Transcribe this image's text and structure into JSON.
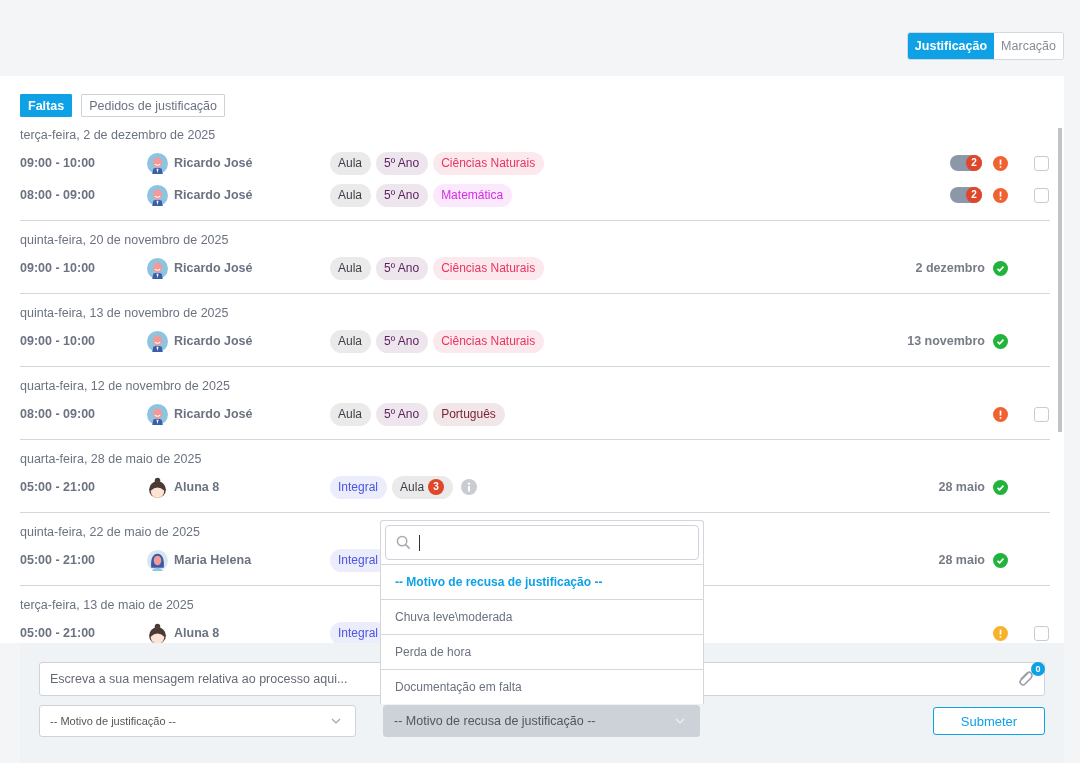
{
  "view_toggle": [
    {
      "label": "Justificação",
      "selected": true
    },
    {
      "label": "Marcação",
      "selected": false
    }
  ],
  "tabs": [
    {
      "label": "Faltas",
      "selected": true
    },
    {
      "label": "Pedidos de justificação",
      "selected": false
    }
  ],
  "groups": [
    {
      "date": "terça-feira, 2 de dezembro de 2025",
      "rows": [
        {
          "time": "09:00 - 10:00",
          "person": "Ricardo José",
          "avatar": {
            "kind": "man"
          },
          "tags": [
            {
              "label": "Aula",
              "color": "#3c3f46"
            },
            {
              "label": "5º Ano",
              "color": "#5c1f5c"
            },
            {
              "label": "Ciências Naturais",
              "color": "#e8345f"
            }
          ],
          "count": "2",
          "status": {
            "kind": "alert"
          },
          "checkbox": {
            "checked": false
          }
        },
        {
          "time": "08:00 - 09:00",
          "person": "Ricardo José",
          "avatar": {
            "kind": "man"
          },
          "tags": [
            {
              "label": "Aula",
              "color": "#3c3f46"
            },
            {
              "label": "5º Ano",
              "color": "#5c1f5c"
            },
            {
              "label": "Matemática",
              "color": "#d62ae6"
            }
          ],
          "count": "2",
          "status": {
            "kind": "alert"
          },
          "checkbox": {
            "checked": false
          }
        }
      ]
    },
    {
      "date": "quinta-feira, 20 de novembro de 2025",
      "rows": [
        {
          "time": "09:00 - 10:00",
          "person": "Ricardo José",
          "avatar": {
            "kind": "man"
          },
          "tags": [
            {
              "label": "Aula",
              "color": "#3c3f46"
            },
            {
              "label": "5º Ano",
              "color": "#5c1f5c"
            },
            {
              "label": "Ciências Naturais",
              "color": "#e8345f"
            }
          ],
          "done_date": "2 dezembro",
          "status": {
            "kind": "ok"
          }
        }
      ]
    },
    {
      "date": "quinta-feira, 13 de novembro de 2025",
      "rows": [
        {
          "time": "09:00 - 10:00",
          "person": "Ricardo José",
          "avatar": {
            "kind": "man"
          },
          "tags": [
            {
              "label": "Aula",
              "color": "#3c3f46"
            },
            {
              "label": "5º Ano",
              "color": "#5c1f5c"
            },
            {
              "label": "Ciências Naturais",
              "color": "#e8345f"
            }
          ],
          "done_date": "13 novembro",
          "status": {
            "kind": "ok"
          }
        }
      ]
    },
    {
      "date": "quarta-feira, 12 de novembro de 2025",
      "rows": [
        {
          "time": "08:00 - 09:00",
          "person": "Ricardo José",
          "avatar": {
            "kind": "man"
          },
          "tags": [
            {
              "label": "Aula",
              "color": "#3c3f46"
            },
            {
              "label": "5º Ano",
              "color": "#5c1f5c"
            },
            {
              "label": "Português",
              "color": "#7c2236"
            }
          ],
          "status": {
            "kind": "alert"
          },
          "checkbox": {
            "checked": false
          }
        }
      ]
    },
    {
      "date": "quarta-feira, 28 de maio de 2025",
      "rows": [
        {
          "time": "05:00 - 21:00",
          "person": "Aluna 8",
          "avatar": {
            "kind": "girl"
          },
          "tags": [
            {
              "label": "Integral",
              "color": "#4a55e0"
            },
            {
              "label": "Aula",
              "color": "#3c3f46",
              "count": "3"
            }
          ],
          "info": true,
          "done_date": "28 maio",
          "status": {
            "kind": "ok"
          }
        }
      ]
    },
    {
      "date": "quinta-feira, 22 de maio de 2025",
      "rows": [
        {
          "time": "05:00 - 21:00",
          "person": "Maria Helena",
          "avatar": {
            "kind": "woman"
          },
          "tags": [
            {
              "label": "Integral",
              "color": "#4a55e0"
            }
          ],
          "done_date": "28 maio",
          "status": {
            "kind": "ok"
          }
        }
      ]
    },
    {
      "date": "terça-feira, 13 de maio de 2025",
      "rows": [
        {
          "time": "05:00 - 21:00",
          "person": "Aluna 8",
          "avatar": {
            "kind": "girl"
          },
          "tags": [
            {
              "label": "Integral",
              "color": "#4a55e0"
            }
          ],
          "status": {
            "kind": "warning"
          },
          "checkbox": {
            "checked": false
          }
        }
      ]
    }
  ],
  "message": {
    "placeholder": "Escreva a sua mensagem relativa ao processo aqui...",
    "attachments": "0"
  },
  "justification_select": {
    "value": "-- Motivo de justificação --"
  },
  "refusal_select": {
    "value": "-- Motivo de recusa de justificação --",
    "expanded": true,
    "options": [
      {
        "label": "-- Motivo de recusa de justificação --",
        "selected": true
      },
      {
        "label": "Chuva leve\\moderada",
        "selected": false
      },
      {
        "label": "Perda de hora",
        "selected": false
      },
      {
        "label": "Documentação em falta",
        "selected": false
      }
    ]
  },
  "submit": "Submeter"
}
